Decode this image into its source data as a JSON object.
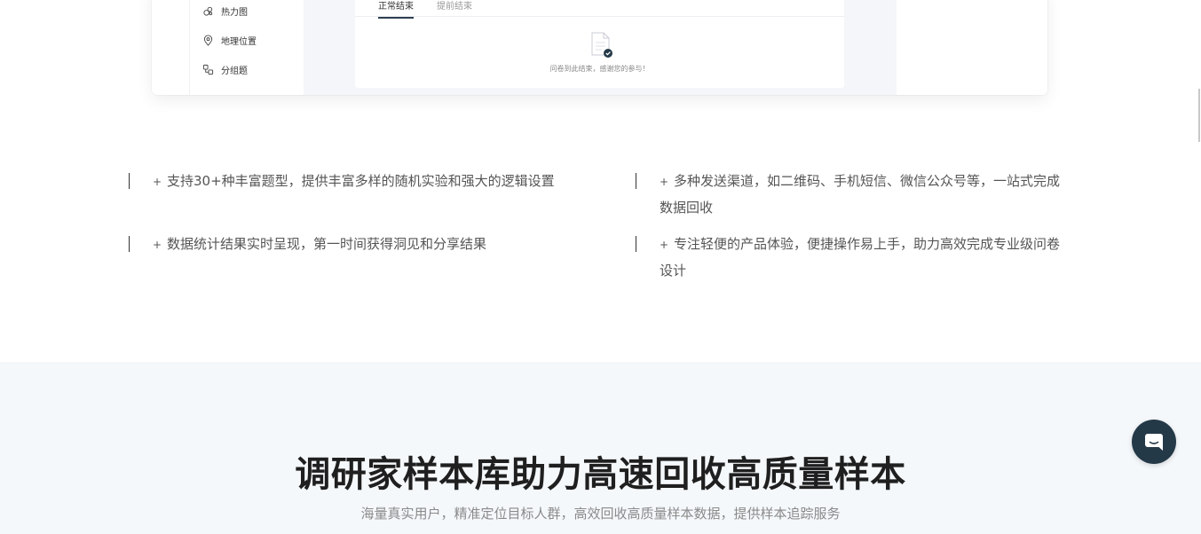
{
  "preview": {
    "sidebar_items": [
      {
        "label": "热力图",
        "icon": "heatmap-icon"
      },
      {
        "label": "地理位置",
        "icon": "location-pin-icon"
      },
      {
        "label": "分组题",
        "icon": "group-icon"
      }
    ],
    "tabs": [
      {
        "label": "正常结束",
        "active": true
      },
      {
        "label": "提前结束",
        "active": false
      }
    ],
    "completion_message": "问卷到此结束，感谢您的参与！"
  },
  "features": [
    "支持30+种丰富题型，提供丰富多样的随机实验和强大的逻辑设置",
    "多种发送渠道，如二维码、手机短信、微信公众号等，一站式完成数据回收",
    "数据统计结果实时呈现，第一时间获得洞见和分享结果",
    "专注轻便的产品体验，便捷操作易上手，助力高效完成专业级问卷设计"
  ],
  "plus_symbol": "+",
  "section": {
    "title": "调研家样本库助力高速回收高质量样本",
    "subtitle": "海量真实用户，精准定位目标人群，高效回收高质量样本数据，提供样本追踪服务"
  },
  "chat": {
    "icon": "chat-bubble-icon"
  },
  "colors": {
    "accent": "#243948",
    "section_bg": "#f5f8fb"
  }
}
